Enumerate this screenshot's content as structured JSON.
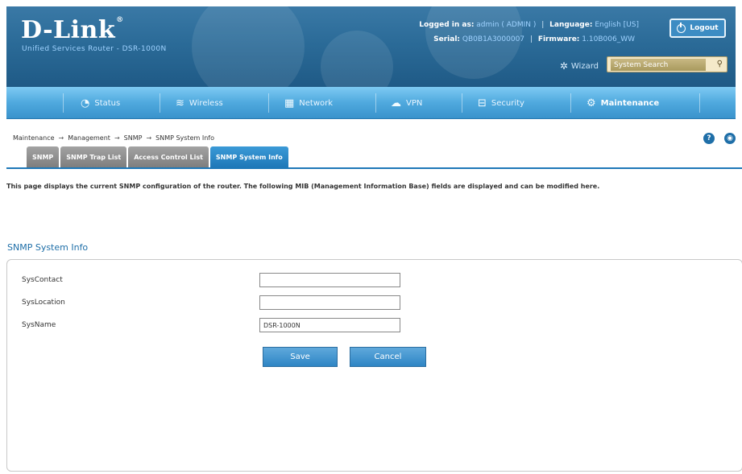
{
  "header": {
    "logo": "D-Link",
    "subtitle": "Unified Services Router - DSR-1000N",
    "logged_in_label": "Logged in as:",
    "logged_in_value": "admin ( ADMIN )",
    "language_label": "Language:",
    "language_value": "English [US]",
    "serial_label": "Serial:",
    "serial_value": "QB0B1A3000007",
    "firmware_label": "Firmware:",
    "firmware_value": "1.10B006_WW",
    "logout_label": "Logout",
    "wizard_label": "Wizard",
    "search_placeholder": "System Search"
  },
  "nav": {
    "items": [
      {
        "label": "Status",
        "icon": "dashboard-icon",
        "active": false
      },
      {
        "label": "Wireless",
        "icon": "wifi-icon",
        "active": false
      },
      {
        "label": "Network",
        "icon": "network-icon",
        "active": false
      },
      {
        "label": "VPN",
        "icon": "cloud-icon",
        "active": false
      },
      {
        "label": "Security",
        "icon": "lock-icon",
        "active": false
      },
      {
        "label": "Maintenance",
        "icon": "gears-icon",
        "active": true
      }
    ]
  },
  "breadcrumb": [
    "Maintenance",
    "Management",
    "SNMP",
    "SNMP System Info"
  ],
  "tabs": [
    {
      "label": "SNMP",
      "active": false
    },
    {
      "label": "SNMP Trap List",
      "active": false
    },
    {
      "label": "Access Control List",
      "active": false
    },
    {
      "label": "SNMP System Info",
      "active": true
    }
  ],
  "description": "This page displays the current SNMP configuration of the router. The following MIB (Management Information Base) fields are displayed and can be modified here.",
  "section_title": "SNMP System Info",
  "form": {
    "fields": [
      {
        "label": "SysContact",
        "value": ""
      },
      {
        "label": "SysLocation",
        "value": ""
      },
      {
        "label": "SysName",
        "value": "DSR-1000N"
      }
    ],
    "save_label": "Save",
    "cancel_label": "Cancel"
  },
  "colors": {
    "header_blue": "#2b6b98",
    "nav_blue": "#4fa9de",
    "tab_active": "#1e78b8",
    "tab_inactive": "#8e8e8e",
    "title_blue": "#1f6fa8"
  }
}
